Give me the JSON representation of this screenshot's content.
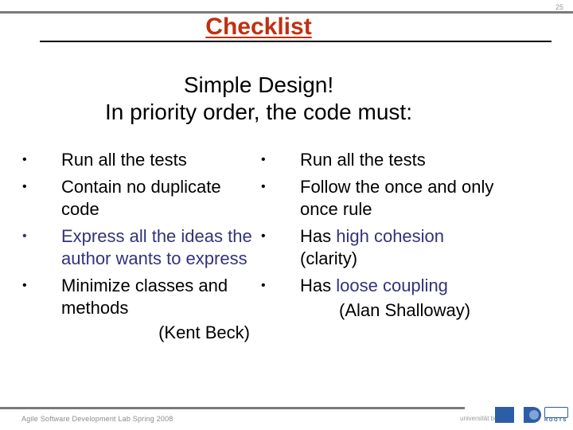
{
  "slide": {
    "page_number": "25",
    "title": "Checklist",
    "subtitle_lines": [
      "Simple Design!",
      "In priority order, the code must:"
    ],
    "colors": {
      "title": "#c1300f",
      "accent": "#33337a",
      "rule": "#7a7a7a"
    }
  },
  "left_column": {
    "items": [
      {
        "text": "Run all the tests"
      },
      {
        "text": "Contain no duplicate code"
      },
      {
        "text": "Express all the ideas the author wants to express"
      },
      {
        "text": "Minimize classes and methods"
      }
    ],
    "attribution": "(Kent Beck)"
  },
  "right_column": {
    "items": [
      {
        "text": "Run all the tests"
      },
      {
        "text": "Follow the  once and only once rule"
      },
      {
        "prefix": "Has ",
        "highlight": "high cohesion",
        "suffix": "(clarity)"
      },
      {
        "prefix": "Has ",
        "highlight": "loose coupling"
      }
    ],
    "attribution": "(Alan Shalloway)"
  },
  "footer": {
    "course": "Agile Software Development Lab Spring 2008",
    "logos": {
      "university": "universität bonn",
      "group": "ROOTS"
    }
  },
  "icons": {
    "bullet": "•"
  }
}
